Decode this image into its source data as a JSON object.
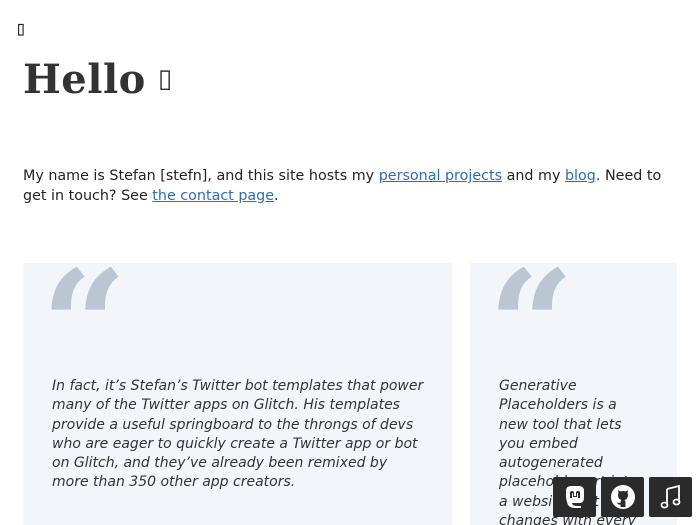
{
  "nav": {
    "menu_icon": "▯"
  },
  "hero": {
    "title": "Hello",
    "wave_icon": "▯"
  },
  "intro": {
    "text_before": "My name is Stefan [stefn], and this site hosts my ",
    "projects_link": "personal projects",
    "text_middle": " and my ",
    "blog_link": "blog",
    "text_after": ". Need to get in touch? See ",
    "contact_link": "the contact page",
    "text_end": "."
  },
  "testimonials": [
    {
      "quote": "In fact, it’s Stefan’s Twitter bot templates that power many of the Twitter apps on Glitch. His templates provide a useful springboard to the throngs of devs who are eager to quickly create a Twitter app or bot on Glitch, and they’ve already been remixed by more than 350 other app creators."
    },
    {
      "quote": "Generative Placeholders is a new tool that lets you embed autogenerated placeholder art into a website that changes with every page refresh."
    }
  ],
  "quote_mark": "“",
  "social": [
    {
      "icon": "mastodon-icon"
    },
    {
      "icon": "github-icon"
    },
    {
      "icon": "music-note-icon"
    }
  ],
  "colors": {
    "link": "#2f6db3",
    "card_bg": "#f2f6fa",
    "quote_mark": "#bcc6d2",
    "fab_bg": "#2b2b2b"
  }
}
